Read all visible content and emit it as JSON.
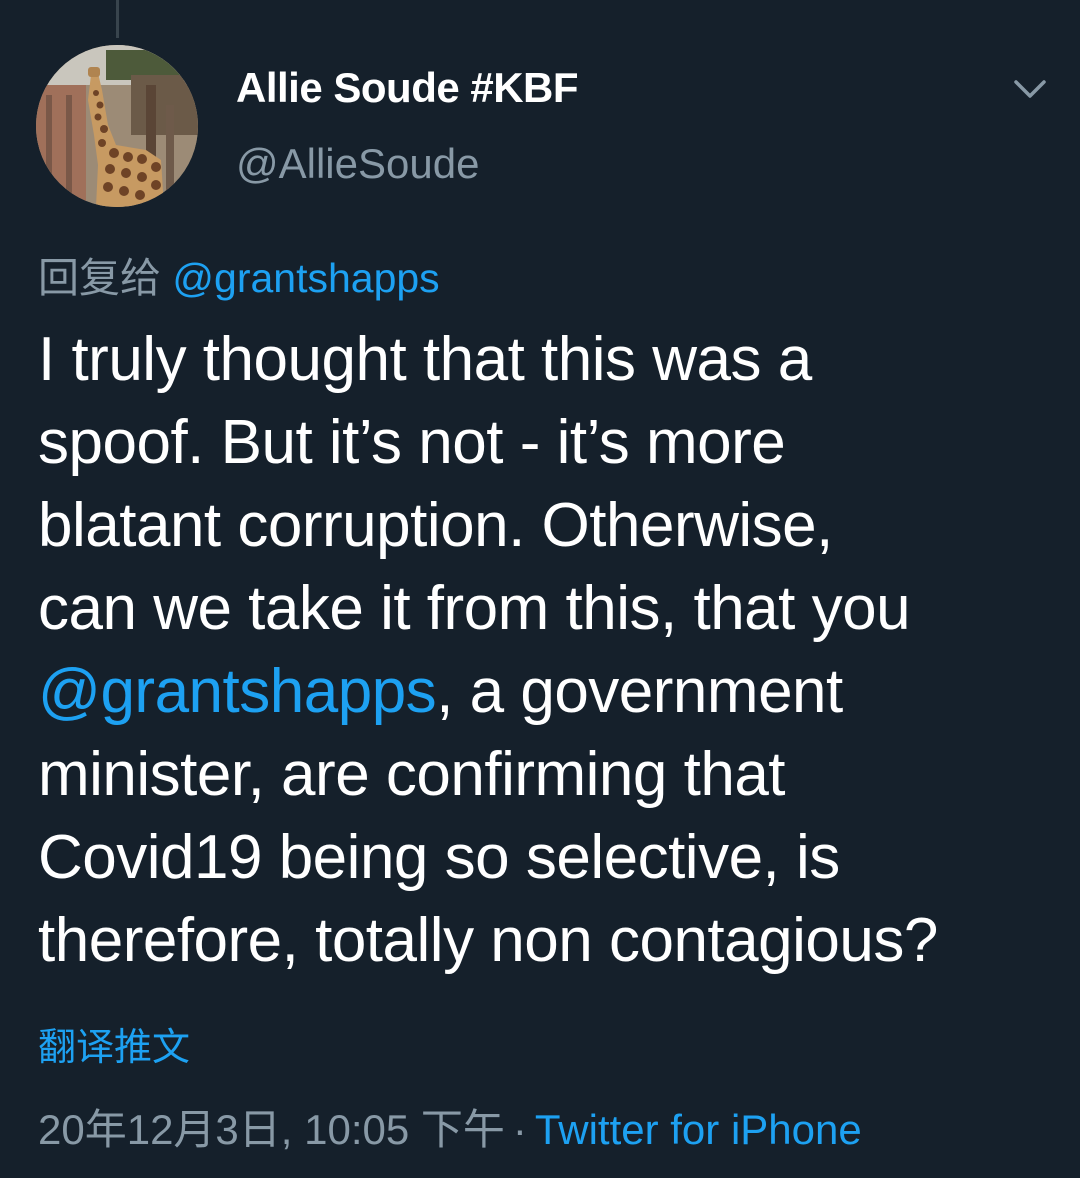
{
  "tweet": {
    "author": {
      "display_name": "Allie Soude #KBF",
      "handle": "@AllieSoude"
    },
    "reply": {
      "prefix": "回复给",
      "mention": "@grantshapps"
    },
    "text_lines": [
      "I truly thought that this was a",
      "spoof. But it’s not - it’s more",
      "blatant corruption.  Otherwise,",
      "can we take it from this, that you",
      "@grantshapps",
      ", a government",
      "minister, are confirming that",
      "Covid19  being so selective, is",
      "therefore, totally non contagious?"
    ],
    "translate_label": "翻译推文",
    "timestamp": "20年12月3日, 10:05 下午",
    "separator": "·",
    "source": "Twitter for iPhone",
    "menu_icon": "chevron-down-icon"
  },
  "colors": {
    "background": "#15202b",
    "text": "#ffffff",
    "secondary": "#8899a6",
    "link": "#1da1f2"
  }
}
